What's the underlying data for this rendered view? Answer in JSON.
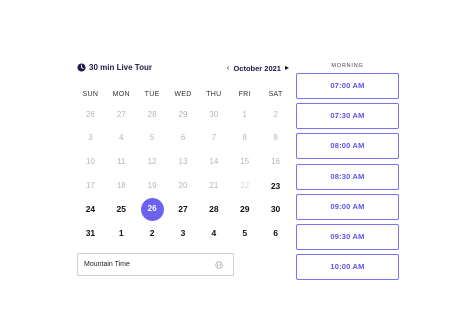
{
  "header": {
    "event_title": "30 min Live Tour",
    "month": "October 2021",
    "prev_icon": "chevron-left-icon",
    "next_icon": "chevron-right-icon",
    "title_icon": "clock-icon"
  },
  "calendar": {
    "days_of_week": [
      "SUN",
      "MON",
      "TUE",
      "WED",
      "THU",
      "FRI",
      "SAT"
    ],
    "selected_color": "#6b63f0",
    "weeks": [
      [
        {
          "label": "26",
          "state": "disabled"
        },
        {
          "label": "27",
          "state": "disabled"
        },
        {
          "label": "28",
          "state": "disabled"
        },
        {
          "label": "29",
          "state": "disabled"
        },
        {
          "label": "30",
          "state": "disabled"
        },
        {
          "label": "1",
          "state": "disabled"
        },
        {
          "label": "2",
          "state": "disabled"
        }
      ],
      [
        {
          "label": "3",
          "state": "disabled"
        },
        {
          "label": "4",
          "state": "disabled"
        },
        {
          "label": "5",
          "state": "disabled"
        },
        {
          "label": "6",
          "state": "disabled"
        },
        {
          "label": "7",
          "state": "disabled"
        },
        {
          "label": "8",
          "state": "disabled"
        },
        {
          "label": "9",
          "state": "disabled"
        }
      ],
      [
        {
          "label": "10",
          "state": "disabled"
        },
        {
          "label": "11",
          "state": "disabled"
        },
        {
          "label": "12",
          "state": "disabled"
        },
        {
          "label": "13",
          "state": "disabled"
        },
        {
          "label": "14",
          "state": "disabled"
        },
        {
          "label": "15",
          "state": "disabled"
        },
        {
          "label": "16",
          "state": "disabled"
        }
      ],
      [
        {
          "label": "17",
          "state": "disabled"
        },
        {
          "label": "18",
          "state": "disabled"
        },
        {
          "label": "19",
          "state": "disabled"
        },
        {
          "label": "20",
          "state": "disabled"
        },
        {
          "label": "21",
          "state": "disabled"
        },
        {
          "label": "22",
          "state": "faded"
        },
        {
          "label": "23",
          "state": "available"
        }
      ],
      [
        {
          "label": "24",
          "state": "available"
        },
        {
          "label": "25",
          "state": "available"
        },
        {
          "label": "26",
          "state": "selected"
        },
        {
          "label": "27",
          "state": "available"
        },
        {
          "label": "28",
          "state": "available"
        },
        {
          "label": "29",
          "state": "available"
        },
        {
          "label": "30",
          "state": "available"
        }
      ],
      [
        {
          "label": "31",
          "state": "available"
        },
        {
          "label": "1",
          "state": "available"
        },
        {
          "label": "2",
          "state": "available"
        },
        {
          "label": "3",
          "state": "available"
        },
        {
          "label": "4",
          "state": "available"
        },
        {
          "label": "5",
          "state": "available"
        },
        {
          "label": "6",
          "state": "available"
        }
      ]
    ]
  },
  "timezone": {
    "label": "Mountain Time",
    "icon": "globe-icon"
  },
  "times": {
    "section_label": "MORNING",
    "accent_color": "#5b54e8",
    "slots": [
      "07:00 AM",
      "07:30 AM",
      "08:00 AM",
      "08:30 AM",
      "09:00 AM",
      "09:30 AM",
      "10:00 AM"
    ]
  }
}
